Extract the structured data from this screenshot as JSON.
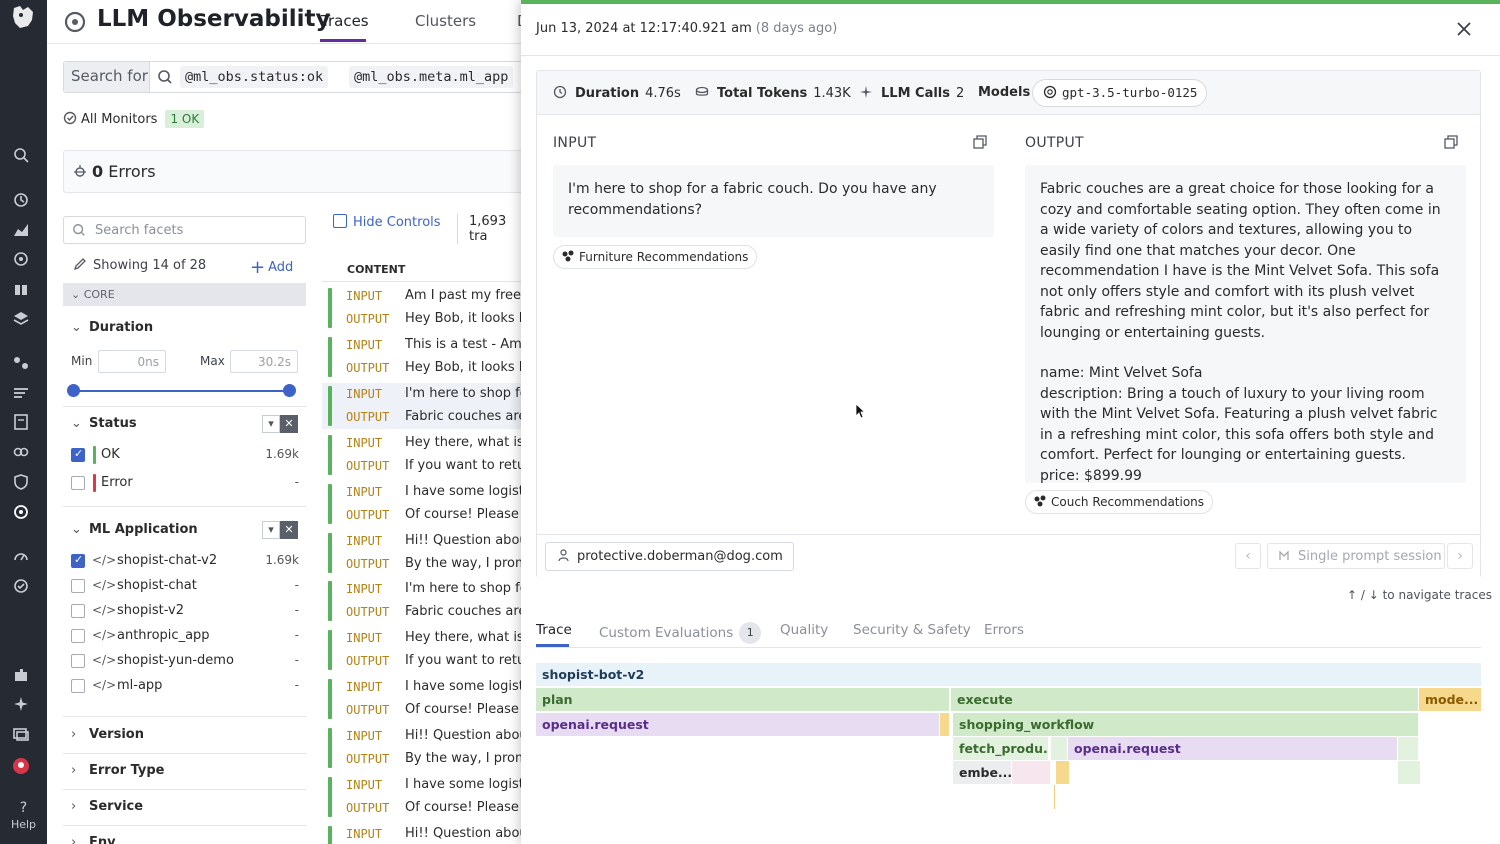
{
  "nav": {
    "help_label": "Help"
  },
  "header": {
    "title": "LLM Observability",
    "tabs": [
      {
        "label": "Traces",
        "active": true
      },
      {
        "label": "Clusters",
        "active": false
      },
      {
        "label": "D",
        "active": false
      }
    ]
  },
  "search": {
    "for_label": "Search for",
    "chips": [
      {
        "key": "@ml_obs.status",
        "value": ":ok"
      },
      {
        "key": "@ml_obs.meta.ml_app",
        "value": ""
      }
    ]
  },
  "monitors": {
    "label": "All Monitors",
    "badge": "1 OK"
  },
  "errors": {
    "count": "0",
    "label": "Errors"
  },
  "facets": {
    "search_placeholder": "Search facets",
    "showing": "Showing 14 of 28",
    "add_label": "Add",
    "core_label": "CORE",
    "duration": {
      "label": "Duration",
      "min_label": "Min",
      "min_value": "0ns",
      "max_label": "Max",
      "max_value": "30.2s"
    },
    "status": {
      "label": "Status",
      "items": [
        {
          "name": "OK",
          "count": "1.69k",
          "checked": true,
          "color": "#58b35c"
        },
        {
          "name": "Error",
          "count": "-",
          "checked": false,
          "color": "#d83a49"
        }
      ]
    },
    "ml_application": {
      "label": "ML Application",
      "items": [
        {
          "name": "shopist-chat-v2",
          "count": "1.69k",
          "checked": true
        },
        {
          "name": "shopist-chat",
          "count": "-",
          "checked": false
        },
        {
          "name": "shopist-v2",
          "count": "-",
          "checked": false
        },
        {
          "name": "anthropic_app",
          "count": "-",
          "checked": false
        },
        {
          "name": "shopist-yun-demo",
          "count": "-",
          "checked": false
        },
        {
          "name": "ml-app",
          "count": "-",
          "checked": false
        }
      ]
    },
    "collapsed": [
      "Version",
      "Error Type",
      "Service",
      "Env"
    ]
  },
  "list": {
    "hide_controls": "Hide Controls",
    "trace_count": "1,693 tra",
    "content_header": "CONTENT",
    "input_key": "INPUT",
    "output_key": "OUTPUT",
    "rows": [
      {
        "input": "Am I past my free r",
        "output": "Hey Bob, it looks lik"
      },
      {
        "input": "This is a test - Am I",
        "output": "Hey Bob, it looks lik"
      },
      {
        "input": "I'm here to shop for",
        "output": "Fabric couches are",
        "selected": true
      },
      {
        "input": "Hey there, what is t",
        "output": "If you want to retur"
      },
      {
        "input": "I have some logistic",
        "output": "Of course! Please g"
      },
      {
        "input": "Hi!! Question about",
        "output": "By the way, I promi"
      },
      {
        "input": "I'm here to shop for",
        "output": "Fabric couches are"
      },
      {
        "input": "Hey there, what is t",
        "output": "If you want to retur"
      },
      {
        "input": "I have some logistic",
        "output": "Of course! Please g"
      },
      {
        "input": "Hi!! Question about",
        "output": "By the way, I promi"
      },
      {
        "input": "I have some logistic",
        "output": "Of course! Please g"
      },
      {
        "input": "Hi!! Question about",
        "output": ""
      }
    ]
  },
  "panel": {
    "timestamp": "Jun 13, 2024 at 12:17:40.921 am",
    "ago": "(8 days ago)",
    "stats": {
      "duration_label": "Duration",
      "duration_value": "4.76s",
      "tokens_label": "Total Tokens",
      "tokens_value": "1.43K",
      "calls_label": "LLM Calls",
      "calls_value": "2",
      "models_label": "Models",
      "model_name": "gpt-3.5-turbo-0125"
    },
    "input": {
      "heading": "INPUT",
      "text": "I'm here to shop for a fabric couch. Do you have any recommendations?",
      "tag": "Furniture Recommendations"
    },
    "output": {
      "heading": "OUTPUT",
      "paragraph1": "Fabric couches are a great choice for those looking for a cozy and comfortable seating option. They often come in a wide variety of colors and textures, allowing you to easily find one that matches your decor. One recommendation I have is the Mint Velvet Sofa. This sofa not only offers style and comfort with its plush velvet fabric and refreshing mint color, but it's also perfect for lounging or entertaining guests.",
      "name_line": "name: Mint Velvet Sofa",
      "description_line": "description: Bring a touch of luxury to your living room with the Mint Velvet Sofa. Featuring a plush velvet fabric in a refreshing mint color, this sofa offers both style and comfort. Perfect for lounging or entertaining guests.",
      "price_line": "price: $899.99",
      "tag": "Couch Recommendations"
    },
    "user": "protective.doberman@dog.com",
    "session_label": "Single prompt session",
    "nav_hint": "↑ / ↓ to navigate traces",
    "tabs": [
      {
        "label": "Trace",
        "active": true
      },
      {
        "label": "Custom Evaluations",
        "badge": "1"
      },
      {
        "label": "Quality"
      },
      {
        "label": "Security & Safety"
      },
      {
        "label": "Errors"
      }
    ],
    "spans": {
      "root": "shopist-bot-v2",
      "plan": "plan",
      "execute": "execute",
      "model": "mode...",
      "openai_request_1": "openai.request",
      "shopping_workflow": "shopping_workflow",
      "fetch_products": "fetch_produ...",
      "openai_request_2": "openai.request",
      "embed": "embe..."
    }
  }
}
